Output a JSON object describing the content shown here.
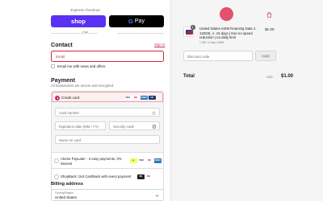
{
  "express": {
    "title": "Express checkout",
    "shop_label": "shop",
    "gpay_label": "Pay",
    "gpay_g": "G",
    "or_label": "OR"
  },
  "contact": {
    "heading": "Contact",
    "sign_in": "Sign in",
    "email_placeholder": "Email",
    "news_label": "Email me with news and offers"
  },
  "payment": {
    "heading": "Payment",
    "note": "All transactions are secure and encrypted.",
    "credit_card": {
      "label": "Credit card",
      "logos": [
        {
          "text": "VISA",
          "color": "#ffffff",
          "fg": "#1a1f71"
        },
        {
          "text": "MC",
          "color": "#ffffff",
          "fg": "#eb001b"
        },
        {
          "text": "AMEX",
          "color": "#2e77bc",
          "fg": "#ffffff"
        },
        {
          "text": "UP",
          "color": "#1a3b6e",
          "fg": "#ffffff"
        }
      ],
      "card_number_placeholder": "Card number",
      "expiration_placeholder": "Expiration date (MM / YY)",
      "security_placeholder": "Security code",
      "name_placeholder": "Name on card"
    },
    "atome": {
      "label": "Atome PayLater - 3 easy payments, 0% interest"
    },
    "shopback": {
      "label": "ShopBack: Get Cashback with every payment"
    }
  },
  "billing": {
    "heading": "Billing address",
    "country_label": "Country/Region",
    "country_value": "United States"
  },
  "summary": {
    "item_qty": "1",
    "item_name": "United States eSIM Roaming Data 1-120GB, 1- 15 days | true no speed reduction | no daily limit",
    "item_variant": "1 GB / 1 Day / eSIM",
    "item_price": "$1.00",
    "discount_placeholder": "Discount code",
    "apply_label": "Apply",
    "total_label": "Total",
    "total_currency": "USD",
    "total_value": "$1.00"
  },
  "colors": {
    "brand": "#c0306e",
    "shop_pay": "#5a31f4",
    "error": "#d8243e"
  }
}
